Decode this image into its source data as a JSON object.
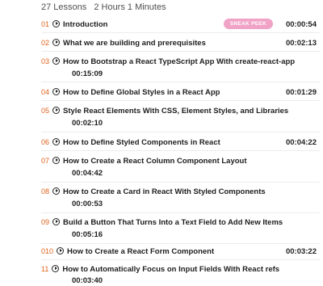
{
  "summary": {
    "lessons": "27 Lessons",
    "duration": "2 Hours 1 Minutes"
  },
  "badge": "SNEAK PEEK",
  "lessons": [
    {
      "num": "01",
      "title": "Introduction",
      "duration": "00:00:54"
    },
    {
      "num": "02",
      "title": "What we are building and prerequisites",
      "duration": "00:02:13"
    },
    {
      "num": "03",
      "title": "How to Bootstrap a React TypeScript App With create-react-app",
      "duration": "00:15:09"
    },
    {
      "num": "04",
      "title": "How to Define Global Styles in a React App",
      "duration": "00:01:29"
    },
    {
      "num": "05",
      "title": "Style React Elements With CSS, Element Styles, and Libraries",
      "duration": "00:02:10"
    },
    {
      "num": "06",
      "title": "How to Define Styled Components in React",
      "duration": "00:04:22"
    },
    {
      "num": "07",
      "title": "How to Create a React Column Component Layout",
      "duration": "00:04:42"
    },
    {
      "num": "08",
      "title": "How to Create a Card in React With Styled Components",
      "duration": "00:00:53"
    },
    {
      "num": "09",
      "title": "Build a Button That Turns Into a Text Field to Add New Items",
      "duration": "00:05:16"
    },
    {
      "num": "010",
      "title": "How to Create a React Form Component",
      "duration": "00:03:22"
    },
    {
      "num": "11",
      "title": "How to Automatically Focus on Input Fields With React refs",
      "duration": "00:03:40"
    }
  ]
}
